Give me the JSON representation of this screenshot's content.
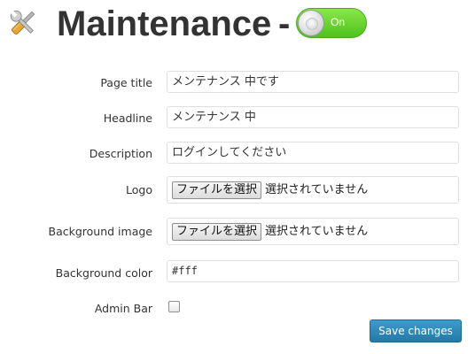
{
  "header": {
    "title": "Maintenance",
    "dash": "-",
    "toggle_label": "On",
    "toggle_on": true
  },
  "form": {
    "page_title": {
      "label": "Page title",
      "value": "メンテナンス 中です"
    },
    "headline": {
      "label": "Headline",
      "value": "メンテナンス 中"
    },
    "description": {
      "label": "Description",
      "value": "ログインしてください"
    },
    "logo": {
      "label": "Logo",
      "button": "ファイルを選択",
      "status": "選択されていません"
    },
    "background_image": {
      "label": "Background image",
      "button": "ファイルを選択",
      "status": "選択されていません"
    },
    "background_color": {
      "label": "Background color",
      "value": "#fff"
    },
    "admin_bar": {
      "label": "Admin Bar",
      "checked": false
    }
  },
  "actions": {
    "save_label": "Save changes"
  },
  "colors": {
    "toggle_on": "#4cc21b",
    "save_button": "#2e8bbf",
    "title_text": "#333333"
  },
  "icons": {
    "header_icon": "tools-wrench-screwdriver-icon"
  }
}
